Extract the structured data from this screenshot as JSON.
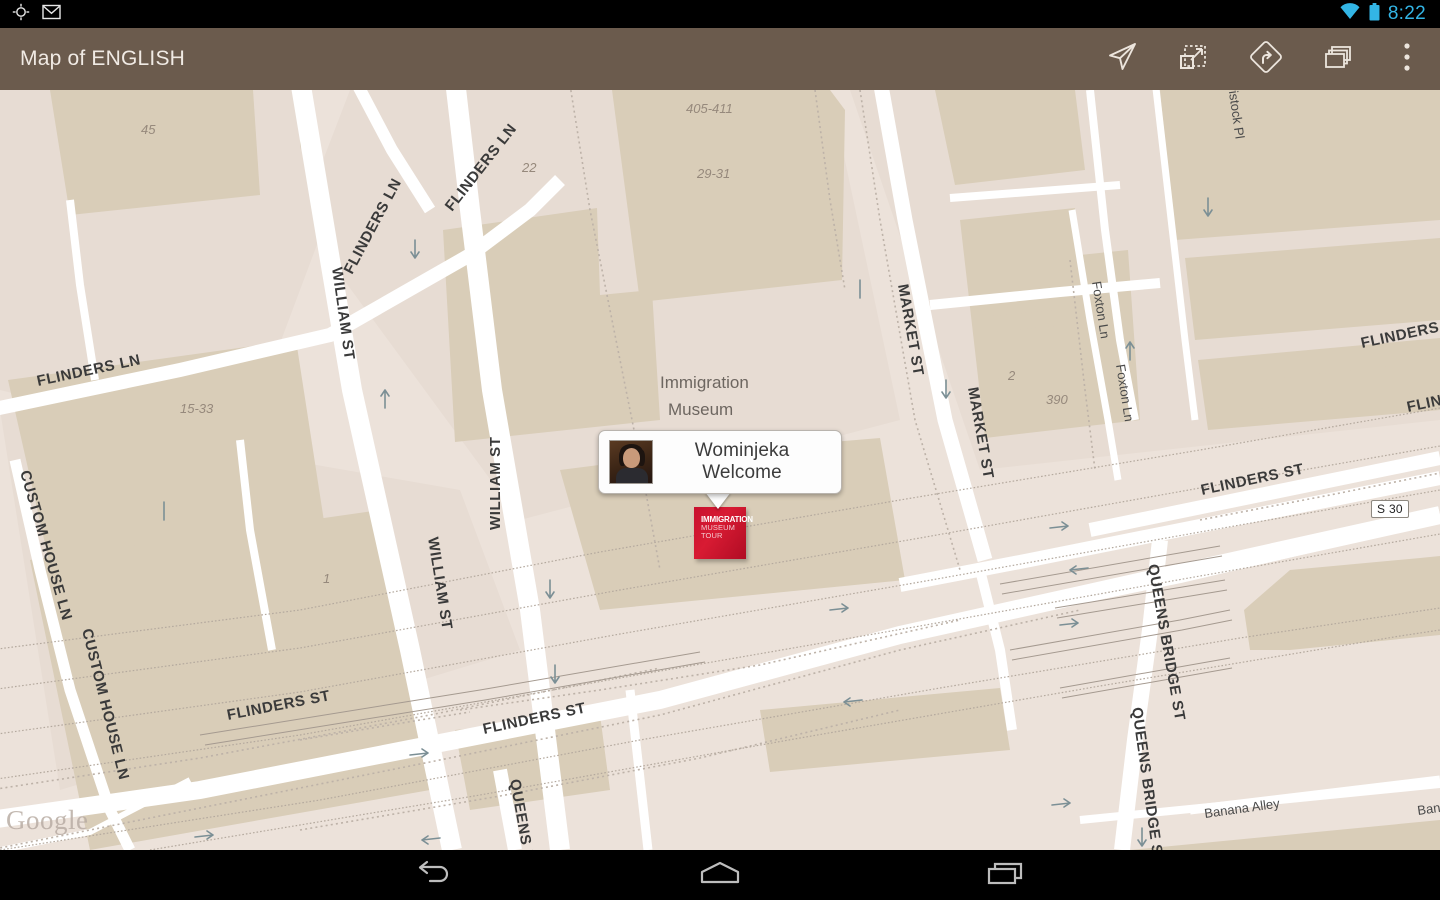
{
  "statusbar": {
    "time": "8:22",
    "icons": [
      "location-icon",
      "gmail-icon",
      "wifi-icon",
      "battery-icon"
    ],
    "accent_color": "#33b5e5"
  },
  "actionbar": {
    "title": "Map of ENGLISH",
    "background_color": "#6b5b4d",
    "actions": [
      {
        "name": "my-location-button",
        "label": "My Location"
      },
      {
        "name": "expand-button",
        "label": "Expand"
      },
      {
        "name": "directions-button",
        "label": "Directions"
      },
      {
        "name": "layers-button",
        "label": "Layers"
      },
      {
        "name": "overflow-menu-button",
        "label": "More options"
      }
    ]
  },
  "map": {
    "attribution": "Google",
    "background_color": "#ece2da",
    "building_color": "#d9cdb8",
    "road_color": "#ffffff",
    "labels": [
      {
        "text": "WILLIAM ST"
      },
      {
        "text": "FLINDERS LN"
      },
      {
        "text": "FLINDERS ST"
      },
      {
        "text": "MARKET ST"
      },
      {
        "text": "QUEENS BRIDGE ST"
      },
      {
        "text": "CUSTOM HOUSE LN"
      },
      {
        "text": "Foxton Ln"
      },
      {
        "text": "Tavistock Pl"
      },
      {
        "text": "Banana Alley"
      },
      {
        "text": "Immigration Museum"
      }
    ],
    "street_names": {
      "william_st": "WILLIAM ST",
      "flinders_ln": "FLINDERS LN",
      "flinders_st": "FLINDERS ST",
      "flinders": "FLINDERS",
      "market_st": "MARKET ST",
      "queens_bridge_st": "QUEENS BRIDGE ST",
      "queens_br": "QUEENS BR",
      "custom_house_ln": "CUSTOM HOUSE LN",
      "foxton_ln": "Foxton Ln",
      "tavistock_pl": "vistock Pl",
      "banana_alley": "Banana Alley",
      "bar_partial": "Ban",
      "flin_partial": "FLIN",
      "fli_partial": "FLI"
    },
    "building_numbers": [
      "45",
      "22",
      "405-411",
      "29-31",
      "15-33",
      "1",
      "2",
      "390"
    ],
    "poi_label": "Museum",
    "poi_label_top": "Immigration",
    "road_shield": "S 30"
  },
  "marker": {
    "name": "immigration-museum-tour-marker",
    "line1": "IMMIGRATION",
    "line2": "MUSEUM",
    "line3": "TOUR",
    "color": "#c8102e"
  },
  "infowindow": {
    "title": "Wominjeka Welcome",
    "thumbnail_alt": "tour-guide-portrait"
  },
  "navbar": {
    "buttons": [
      {
        "name": "back-button",
        "label": "Back"
      },
      {
        "name": "home-button",
        "label": "Home"
      },
      {
        "name": "recents-button",
        "label": "Recent apps"
      }
    ]
  }
}
